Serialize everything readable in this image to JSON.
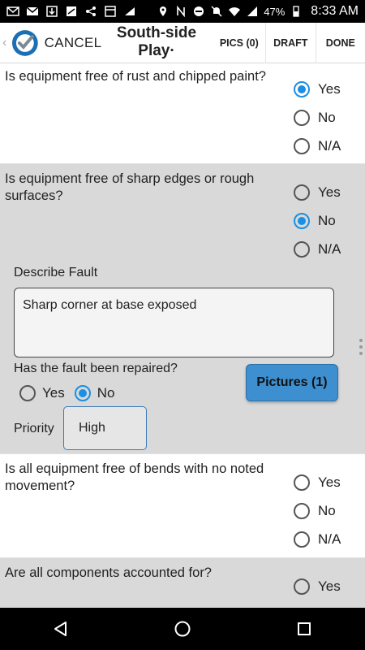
{
  "status_bar": {
    "battery": "47%",
    "time": "8:33 AM"
  },
  "header": {
    "cancel_label": "CANCEL",
    "title": "South-side Play·",
    "pics_label": "PICS (0)",
    "draft_label": "DRAFT",
    "done_label": "DONE"
  },
  "questions": [
    {
      "text": "Is equipment free of rust and chipped paint?",
      "options": [
        "Yes",
        "No",
        "N/A"
      ],
      "selected": "Yes"
    },
    {
      "text": "Is equipment free of sharp edges or rough surfaces?",
      "options": [
        "Yes",
        "No",
        "N/A"
      ],
      "selected": "No",
      "fault": {
        "describe_label": "Describe Fault",
        "description": "Sharp corner at base exposed",
        "repaired_question": "Has the fault been repaired?",
        "repaired_options": [
          "Yes",
          "No"
        ],
        "repaired_selected": "No",
        "pictures_label": "Pictures (1)",
        "priority_label": "Priority",
        "priority_value": "High"
      }
    },
    {
      "text": "Is all equipment free of bends with no noted movement?",
      "options": [
        "Yes",
        "No",
        "N/A"
      ],
      "selected": null
    },
    {
      "text": "Are all components accounted for?",
      "options": [
        "Yes"
      ],
      "selected": null
    }
  ],
  "colors": {
    "accent": "#1a8fe3",
    "pictures_button": "#3d8fd0",
    "gray_section": "#d9d9d9"
  }
}
